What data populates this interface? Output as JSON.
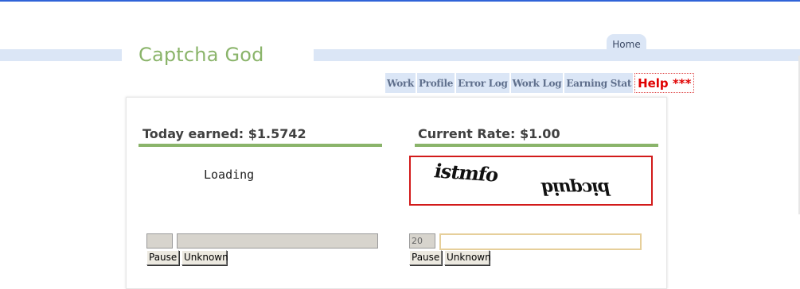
{
  "brand": {
    "title": "Captcha God"
  },
  "tabs": {
    "home": "Home"
  },
  "nav": {
    "items": [
      "Work",
      "Profile",
      "Error Log",
      "Work Log",
      "Earning Stat"
    ],
    "help": "Help ***"
  },
  "left": {
    "heading": "Today earned: $1.5742",
    "status": "Loading",
    "count_value": "",
    "answer_value": "",
    "pause": "Pause",
    "unknown": "Unknown"
  },
  "right": {
    "heading": "Current Rate: $1.00",
    "captcha_line1": "istmfo",
    "captcha_line2": "bicquid",
    "count_value": "20",
    "answer_value": "",
    "pause": "Pause",
    "unknown": "Unknown"
  },
  "colors": {
    "accent_green": "#8ab46a",
    "nav_bg": "#dbe6f6",
    "help_red": "#e00000",
    "captcha_border": "#d21a1a"
  }
}
